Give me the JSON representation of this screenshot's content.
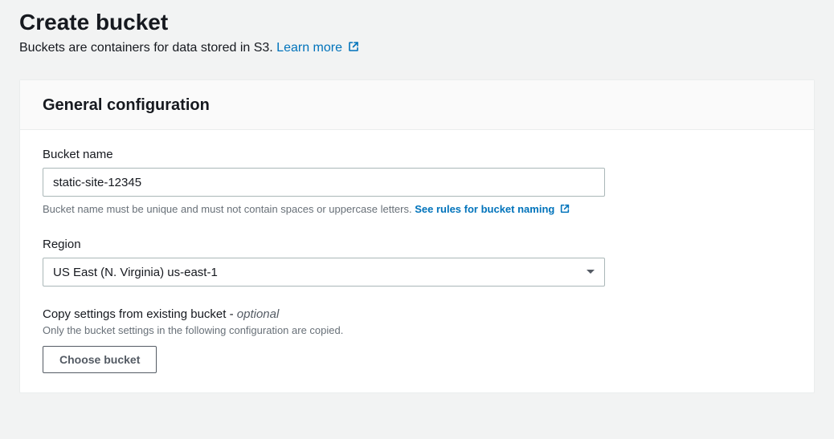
{
  "header": {
    "title": "Create bucket",
    "subtitle_text": "Buckets are containers for data stored in S3. ",
    "learn_more": "Learn more"
  },
  "panel": {
    "title": "General configuration"
  },
  "bucket_name": {
    "label": "Bucket name",
    "value": "static-site-12345",
    "help_text": "Bucket name must be unique and must not contain spaces or uppercase letters. ",
    "rules_link": "See rules for bucket naming"
  },
  "region": {
    "label": "Region",
    "selected": "US East (N. Virginia) us-east-1"
  },
  "copy_settings": {
    "label": "Copy settings from existing bucket - ",
    "optional": "optional",
    "help": "Only the bucket settings in the following configuration are copied.",
    "button": "Choose bucket"
  }
}
